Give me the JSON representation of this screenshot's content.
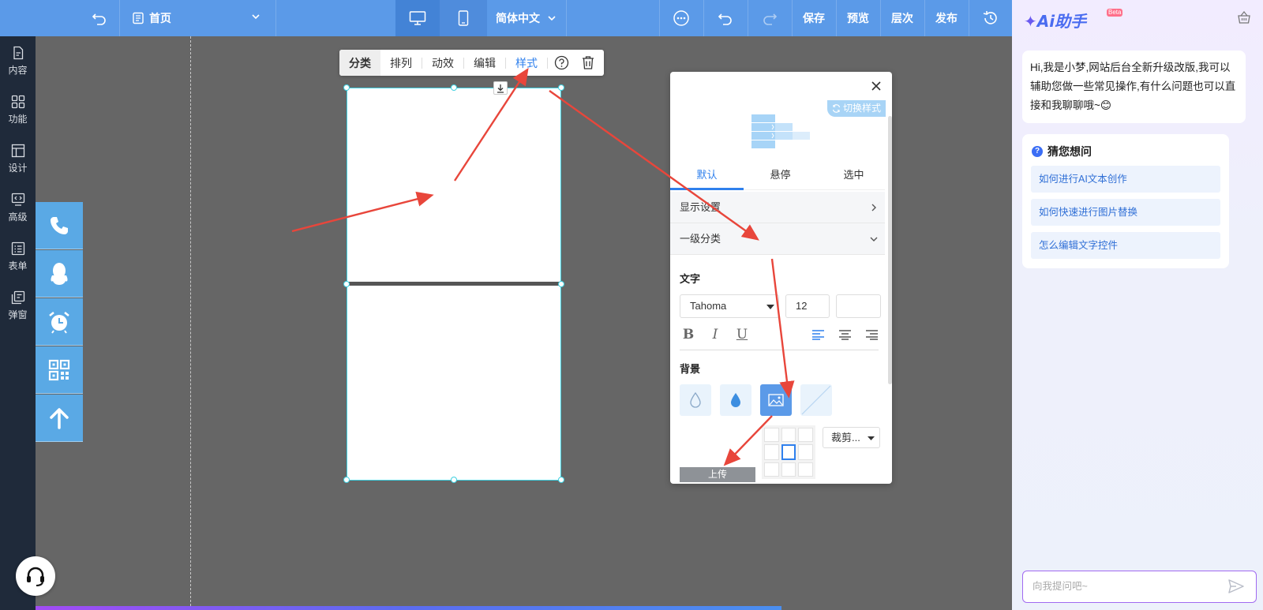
{
  "topbar": {
    "page_name": "首页",
    "language": "简体中文",
    "save": "保存",
    "preview": "预览",
    "layers": "层次",
    "publish": "发布"
  },
  "sidebar": {
    "items": [
      {
        "label": "内容",
        "icon": "document-icon"
      },
      {
        "label": "功能",
        "icon": "grid-icon"
      },
      {
        "label": "设计",
        "icon": "layout-icon"
      },
      {
        "label": "高级",
        "icon": "code-icon"
      },
      {
        "label": "表单",
        "icon": "form-icon"
      },
      {
        "label": "弹窗",
        "icon": "popup-icon"
      }
    ]
  },
  "float_bar": {
    "icons": [
      "phone-icon",
      "qq-icon",
      "alarm-clock-icon",
      "qrcode-icon",
      "arrow-up-icon"
    ]
  },
  "element_toolbar": {
    "category": "分类",
    "arrange": "排列",
    "animation": "动效",
    "edit": "编辑",
    "style": "样式"
  },
  "style_panel": {
    "switch_style": "切换样式",
    "tabs": [
      "默认",
      "悬停",
      "选中"
    ],
    "rows": {
      "display_settings": "显示设置",
      "level1_category": "一级分类"
    },
    "text_section": "文字",
    "font_family": "Tahoma",
    "font_size": "12",
    "color_value": "",
    "background_section": "背景",
    "crop_option": "裁剪...",
    "upload": "上传"
  },
  "ai_panel": {
    "title": "Ai助手",
    "badge": "Beta",
    "greeting": "Hi,我是小梦,网站后台全新升级改版,我可以辅助您做一些常见操作,有什么问题也可以直接和我聊聊哦~😊",
    "guess_title": "猜您想问",
    "suggestions": [
      "如何进行AI文本创作",
      "如何快速进行图片替换",
      "怎么编辑文字控件"
    ],
    "input_placeholder": "向我提问吧~"
  },
  "colors": {
    "topbar": "#5b9ae8",
    "sidebar": "#1f2a3a",
    "accent": "#2f80ed",
    "float_bar": "#5aa9e5",
    "annotation_arrow": "#e8463b"
  }
}
